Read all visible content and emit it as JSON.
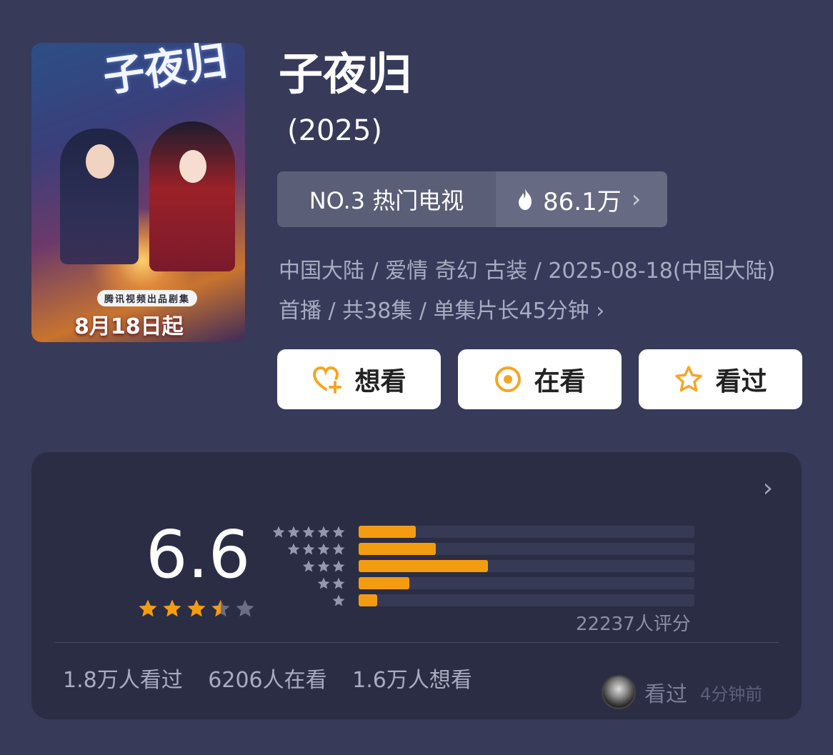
{
  "poster": {
    "calligraphy": "子夜归",
    "subtitle": "腾讯视频出品剧集",
    "date_text": "8月18日起"
  },
  "title": "子夜归",
  "year": "(2025)",
  "rank": {
    "label": "NO.3 热门电视",
    "heat": "86.1万",
    "chevron": "›"
  },
  "meta": {
    "line": "中国大陆 / 爱情 奇幻 古装 / 2025-08-18(中国大陆) 首播 / 共38集 / 单集片长45分钟",
    "chevron": "›"
  },
  "actions": [
    {
      "label": "想看",
      "icon": "heart-plus-icon"
    },
    {
      "label": "在看",
      "icon": "target-circle-icon"
    },
    {
      "label": "看过",
      "icon": "star-outline-icon"
    }
  ],
  "rating": {
    "score": "6.6",
    "star_value": 3.5,
    "count_text": "22237人评分",
    "distribution": [
      {
        "stars": 5,
        "fraction": 0.17
      },
      {
        "stars": 4,
        "fraction": 0.23
      },
      {
        "stars": 3,
        "fraction": 0.385
      },
      {
        "stars": 2,
        "fraction": 0.15
      },
      {
        "stars": 1,
        "fraction": 0.055
      }
    ],
    "chevron": "›"
  },
  "stats": {
    "watched": "1.8万人看过",
    "watching": "6206人在看",
    "want": "1.6万人想看"
  },
  "recent": {
    "label": "看过",
    "time": "4分钟前"
  },
  "colors": {
    "background": "#373a59",
    "card": "#2b2d45",
    "accent": "#f39c12",
    "icon_orange": "#f5a623"
  }
}
